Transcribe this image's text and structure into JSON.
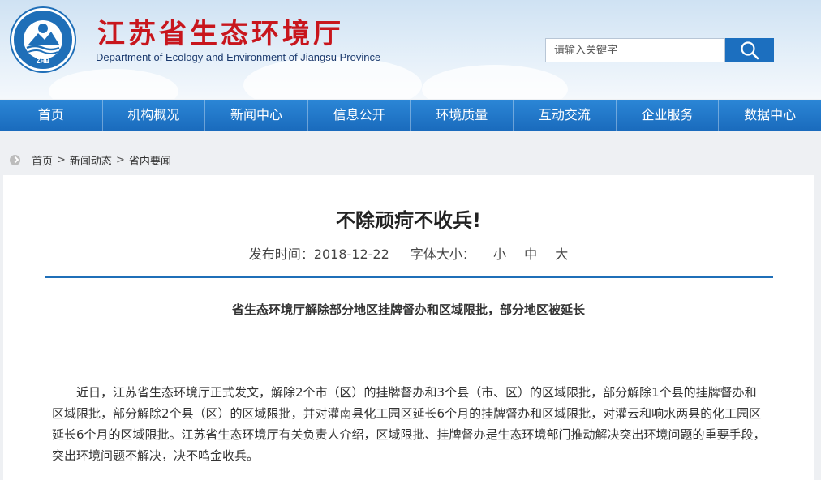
{
  "header": {
    "logo_text": "ZHB",
    "title": "江苏省生态环境厅",
    "subtitle": "Department of Ecology and Environment of Jiangsu Province"
  },
  "search": {
    "placeholder": "请输入关键字",
    "icon": "search-icon"
  },
  "nav": {
    "items": [
      "首页",
      "机构概况",
      "新闻中心",
      "信息公开",
      "环境质量",
      "互动交流",
      "企业服务",
      "数据中心"
    ]
  },
  "breadcrumb": {
    "items": [
      "首页",
      "新闻动态",
      "省内要闻"
    ],
    "separator": ">"
  },
  "article": {
    "title": "不除顽疴不收兵!",
    "publish_label": "发布时间：2018-12-22",
    "font_size_label": "字体大小：",
    "font_sizes": [
      "小",
      "中",
      "大"
    ],
    "lead": "省生态环境厅解除部分地区挂牌督办和区域限批，部分地区被延长",
    "body": "近日，江苏省生态环境厅正式发文，解除2个市（区）的挂牌督办和3个县（市、区）的区域限批，部分解除1个县的挂牌督办和区域限批，部分解除2个县（区）的区域限批，并对灌南县化工园区延长6个月的挂牌督办和区域限批，对灌云和响水两县的化工园区延长6个月的区域限批。江苏省生态环境厅有关负责人介绍，区域限批、挂牌督办是生态环境部门推动解决突出环境问题的重要手段，突出环境问题不解决，决不鸣金收兵。"
  },
  "colors": {
    "brand_red": "#c8161d",
    "nav_blue": "#1a6bbd",
    "divider_blue": "#1f6fb8"
  }
}
